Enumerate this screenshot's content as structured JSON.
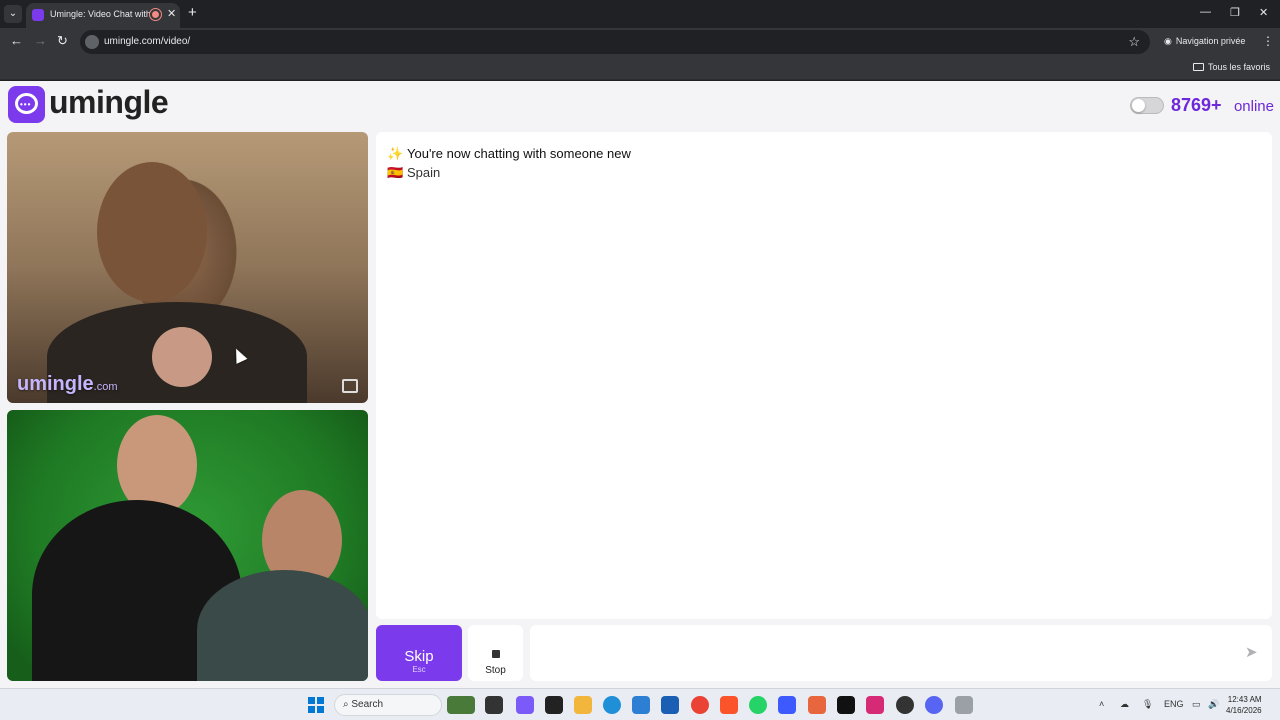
{
  "browser": {
    "tab_title": "Umingle: Video Chat with S",
    "url": "umingle.com/video/",
    "private_label": "Navigation privée",
    "bookmarks_all": "Tous les favoris"
  },
  "site": {
    "logo_text": "umingle",
    "online_count": "8769+",
    "online_label": "online",
    "watermark": "umingle",
    "watermark_suffix": ".com"
  },
  "chat": {
    "status_message": "You're now chatting with someone new",
    "status_emoji": "✨",
    "country_flag": "🇪🇸",
    "country": "Spain",
    "message_placeholder": ""
  },
  "controls": {
    "skip_label": "Skip",
    "skip_hint": "Esc",
    "stop_label": "Stop"
  },
  "taskbar": {
    "search_label": "Search",
    "lang": "ENG",
    "time": "12:43 AM",
    "date": "4/16/2026"
  },
  "colors": {
    "brand": "#7c3aed",
    "online_text": "#6d28d9"
  }
}
